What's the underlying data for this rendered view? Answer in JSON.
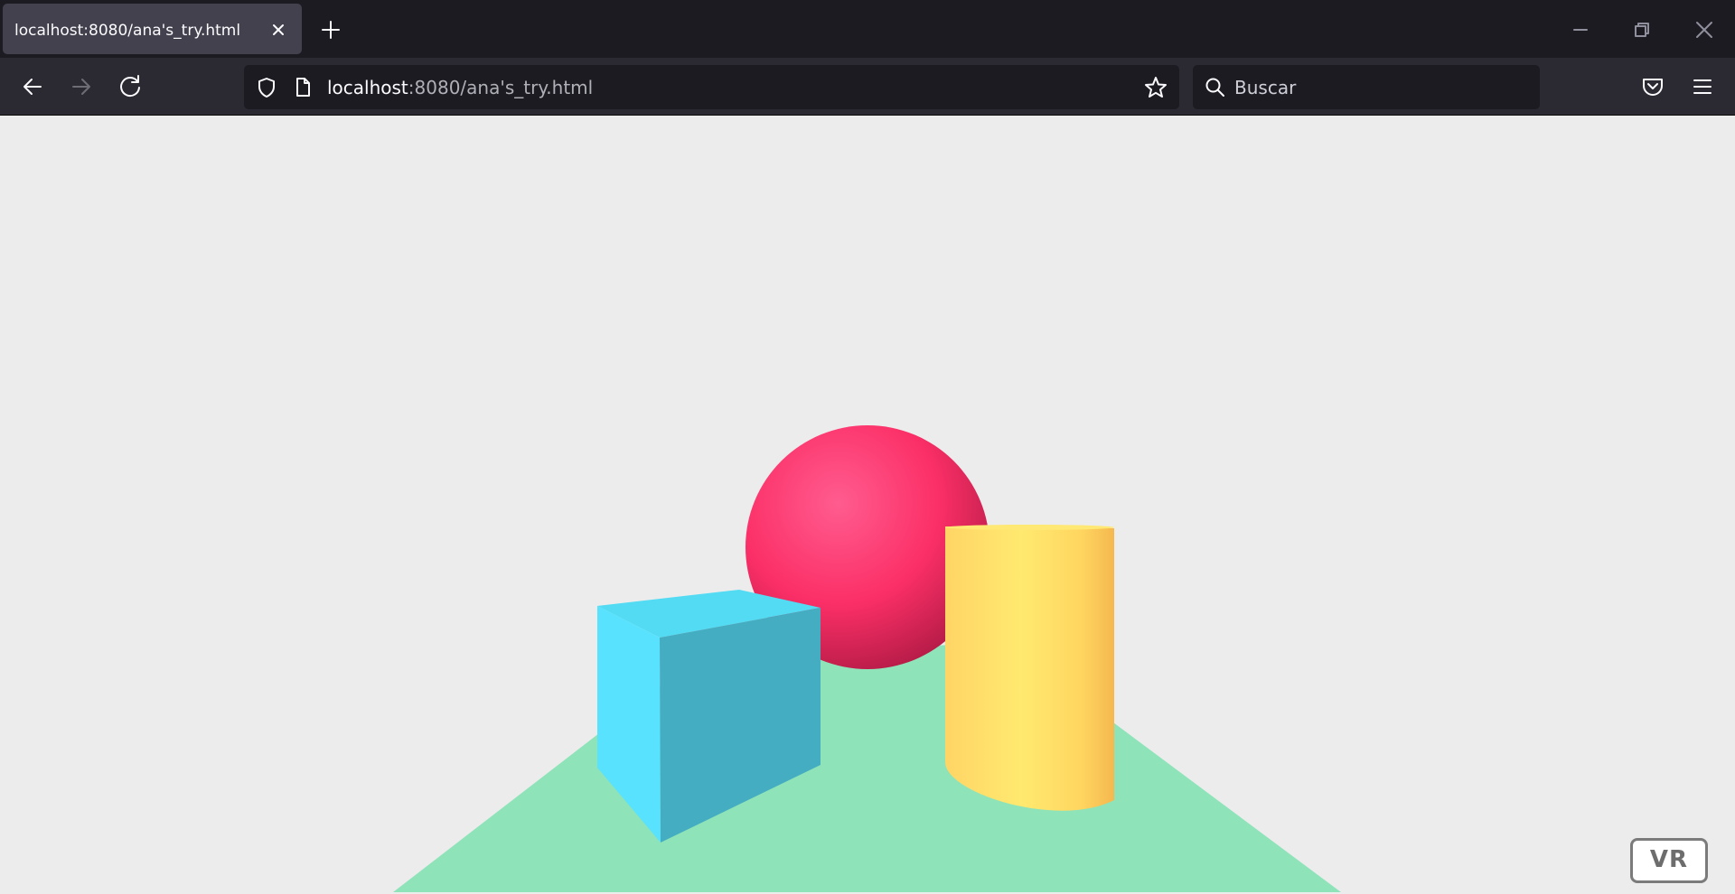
{
  "browser": {
    "tab": {
      "title": "localhost:8080/ana's_try.html"
    },
    "url": {
      "host": "localhost",
      "rest": ":8080/ana's_try.html"
    },
    "search": {
      "placeholder": "Buscar"
    }
  },
  "page": {
    "vr_button_label": "VR",
    "background": "#ececec",
    "scene_objects": [
      {
        "name": "ground-plane",
        "color": "#8ee3b9"
      },
      {
        "name": "sphere",
        "color": "#ff3a75"
      },
      {
        "name": "cube",
        "color": "#4fd0ea"
      },
      {
        "name": "cylinder",
        "color": "#ffe46b"
      }
    ]
  }
}
